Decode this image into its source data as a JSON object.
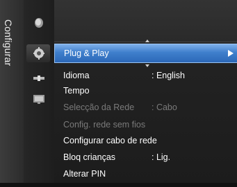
{
  "side": {
    "label": "Configurar"
  },
  "icons": [
    "picture-icon",
    "setup-gear-icon",
    "satellite-icon",
    "input-icon"
  ],
  "menu": {
    "items": [
      {
        "label": "Plug & Play",
        "value": "",
        "state": "highlighted"
      },
      {
        "label": "Idioma",
        "value": ": English",
        "state": "normal"
      },
      {
        "label": "Tempo",
        "value": "",
        "state": "normal"
      },
      {
        "label": "Selecção da Rede",
        "value": ": Cabo",
        "state": "disabled"
      },
      {
        "label": "Config. rede sem fios",
        "value": "",
        "state": "disabled"
      },
      {
        "label": "Configurar cabo de rede",
        "value": "",
        "state": "normal"
      },
      {
        "label": "Bloq crianças",
        "value": ": Lig.",
        "state": "normal"
      },
      {
        "label": "Alterar PIN",
        "value": "",
        "state": "normal"
      }
    ]
  },
  "colors": {
    "highlight": "#3f7fcc",
    "disabled_text": "#7a7a7a"
  }
}
